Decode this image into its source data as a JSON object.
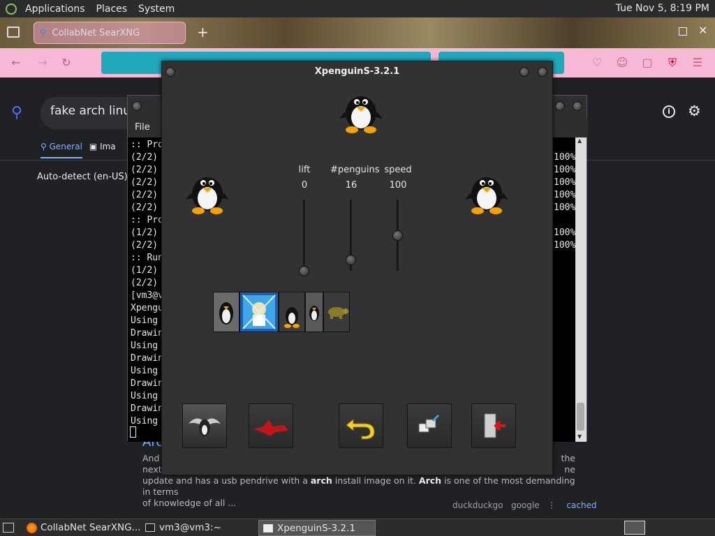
{
  "top_panel": {
    "menus": [
      "Applications",
      "Places",
      "System"
    ],
    "clock": "Tue Nov  5,  8:19 PM"
  },
  "firefox": {
    "tab_title": "CollabNet SearXNG",
    "new_tab": "+"
  },
  "searx": {
    "query": "fake arch linux u",
    "tab_general": "General",
    "tab_images": "Ima",
    "language": "Auto-detect (en-US)",
    "result_title_fragment": "Arc",
    "snippet": {
      "p1": "And",
      "p1_tail": "the",
      "p2": "next",
      "p2_tail": "ne",
      "p3_pre": "update and has a usb pendrive with a ",
      "p3_bold1": "arch",
      "p3_mid": " install image on it. ",
      "p3_bold2": "Arch",
      "p3_post": " is one of the most demanding in terms",
      "p4": "of knowledge of all ..."
    },
    "engines": [
      "duckduckgo",
      "google"
    ],
    "cached": "cached"
  },
  "terminal": {
    "menu_file": "File",
    "lines": [
      ":: Pro",
      "(2/2)",
      "(2/2)",
      "(2/2)",
      "(2/2)",
      "(2/2)",
      ":: Pro",
      "(1/2)",
      "(2/2)",
      ":: Run",
      "(1/2)",
      "(2/2)",
      "[vm3@v",
      "Xpengu",
      "Using",
      "Drawin",
      "Using",
      "Drawin",
      "Using",
      "Drawin",
      "Using",
      "Drawin",
      "Using"
    ],
    "percent_lines": [
      "100%",
      "100%",
      "100%",
      "100%",
      "100%",
      "",
      "100%",
      "100%"
    ]
  },
  "xpenguins": {
    "title": "XpenguinS-3.2.1",
    "sliders": [
      {
        "label": "lift",
        "value": "0",
        "level": 0.0
      },
      {
        "label": "#penguins",
        "value": "16",
        "level": 0.16
      },
      {
        "label": "speed",
        "value": "100",
        "level": 0.5
      }
    ]
  },
  "taskbar": {
    "tasks": [
      "CollabNet SearXNG...",
      "vm3@vm3:~",
      "XpenguinS-3.2.1"
    ]
  }
}
